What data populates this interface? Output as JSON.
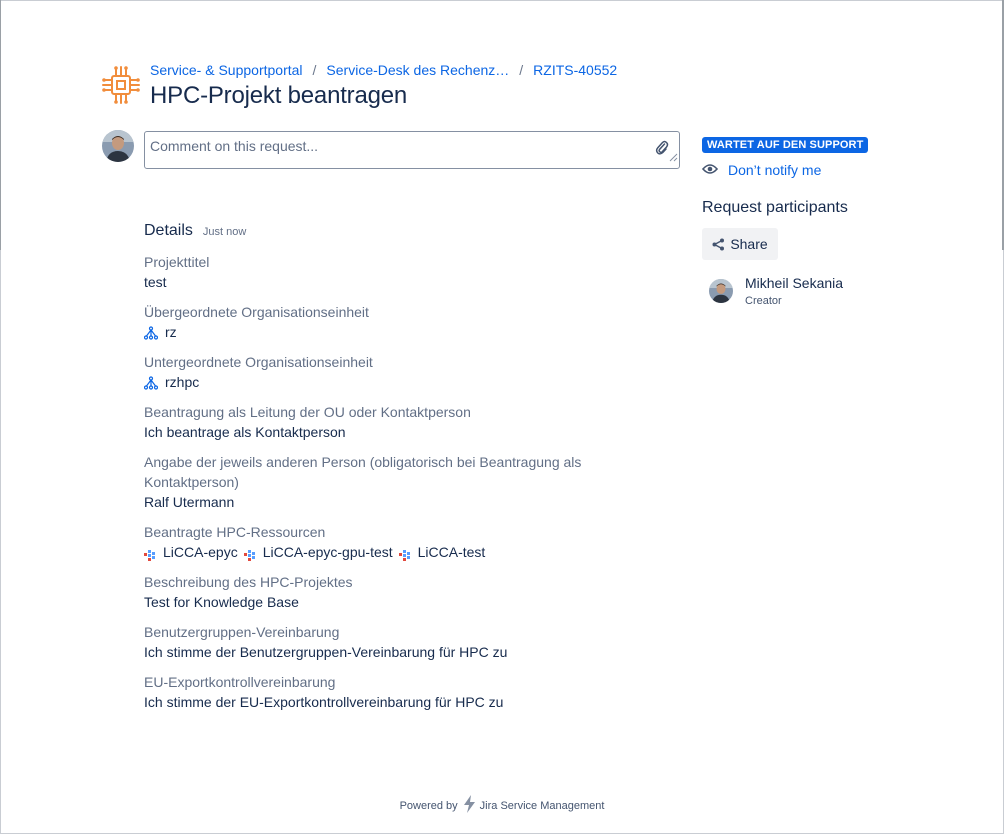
{
  "breadcrumb": {
    "items": [
      "Service- & Supportportal",
      "Service-Desk des Rechenz…",
      "RZITS-40552"
    ],
    "separator": "/"
  },
  "page_title": "HPC-Projekt beantragen",
  "comment": {
    "placeholder": "Comment on this request..."
  },
  "details": {
    "heading": "Details",
    "timestamp": "Just now",
    "fields": [
      {
        "label": "Projekttitel",
        "value": "test"
      },
      {
        "label": "Übergeordnete Organisationseinheit",
        "value": "rz",
        "icon": "org-hierarchy-icon"
      },
      {
        "label": "Untergeordnete Organisationseinheit",
        "value": "rzhpc",
        "icon": "org-hierarchy-icon"
      },
      {
        "label": "Beantragung als Leitung der OU oder Kontaktperson",
        "value": "Ich beantrage als Kontaktperson"
      },
      {
        "label": "Angabe der jeweils anderen Person (obligatorisch bei Beantragung als",
        "label2": "Kontaktperson)",
        "value": "Ralf Utermann"
      },
      {
        "label": "Beantragte HPC-Ressourcen",
        "resources": [
          "LiCCA-epyc",
          "LiCCA-epyc-gpu-test",
          "LiCCA-test"
        ]
      },
      {
        "label": "Beschreibung des HPC-Projektes",
        "value": "Test for Knowledge Base"
      },
      {
        "label": "Benutzergruppen-Vereinbarung",
        "value": "Ich stimme der Benutzergruppen-Vereinbarung für HPC zu"
      },
      {
        "label": "EU-Exportkontrollvereinbarung",
        "value": "Ich stimme der EU-Exportkontrollvereinbarung für HPC zu"
      }
    ]
  },
  "sidebar": {
    "status": "WARTET AUF DEN SUPPORT",
    "notify_label": "Don’t notify me",
    "participants_title": "Request participants",
    "share_label": "Share",
    "participant": {
      "name": "Mikheil Sekania",
      "role": "Creator"
    }
  },
  "footer": {
    "powered_by": "Powered by",
    "product": "Jira Service Management"
  },
  "colors": {
    "link": "#0c66e4",
    "status": "#0c66e4",
    "logo": "#f18d3c",
    "text": "#172b4d",
    "subtle": "#626f86"
  }
}
